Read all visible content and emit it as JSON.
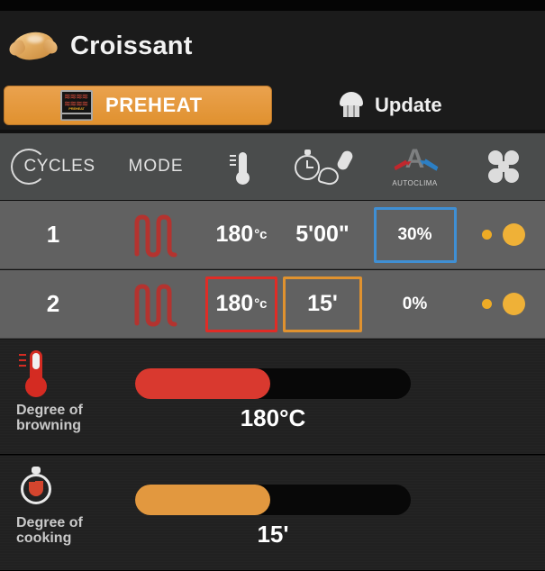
{
  "window": {
    "title": "Croissant",
    "product_icon": "croissant-icon"
  },
  "actionbar": {
    "preheat_label": "PREHEAT",
    "preheat_icon": "oven-preheat-icon",
    "preheat_icon_text": "PREHEAT",
    "update_label": "Update",
    "update_icon": "chef-hat-icon",
    "preheat_active_color": "#e0912f"
  },
  "columns": {
    "cycles_label": "CYCLES",
    "mode_label": "MODE",
    "temperature_icon": "thermometer-icon",
    "time_icon": "stopwatch-brush-icon",
    "autoclima_icon": "autoclima-logo-icon",
    "autoclima_text": "AUTOCLIMA",
    "autoclima_letter": "A",
    "fan_icon": "fan-icon"
  },
  "cycles": [
    {
      "number": "1",
      "mode_icon": "heating-coil-icon",
      "temperature": "180",
      "temperature_unit": "°c",
      "time": "5'00\"",
      "humidity": "30%",
      "temperature_selected": false,
      "time_selected": false,
      "humidity_selected": true,
      "fan_small": true,
      "fan_large": true
    },
    {
      "number": "2",
      "mode_icon": "heating-coil-icon",
      "temperature": "180",
      "temperature_unit": "°c",
      "time": "15'",
      "humidity": "0%",
      "temperature_selected": true,
      "time_selected": true,
      "humidity_selected": false,
      "fan_small": true,
      "fan_large": true
    }
  ],
  "sliders": [
    {
      "id": "browning",
      "icon": "red-thermometer-icon",
      "caption_line1": "Degree of",
      "caption_line2": "browning",
      "value_label": "180°C",
      "fill_percent": 49,
      "fill_color": "#d9392f"
    },
    {
      "id": "cooking",
      "icon": "stopwatch-icon",
      "caption_line1": "Degree of",
      "caption_line2": "cooking",
      "value_label": "15'",
      "fill_percent": 49,
      "fill_color": "#e2983f"
    }
  ],
  "selection_colors": {
    "red": "#e02c26",
    "orange": "#e0922f",
    "blue": "#3f8fd4"
  }
}
